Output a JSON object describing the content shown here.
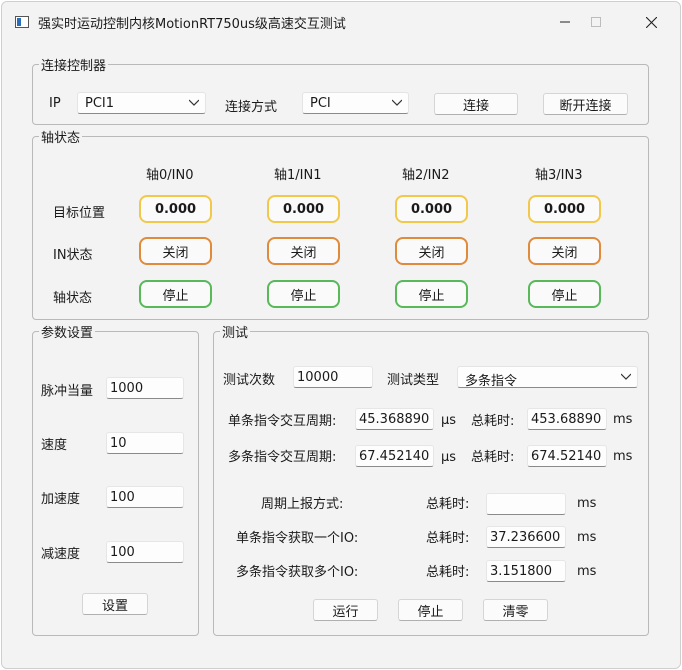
{
  "window": {
    "title": "强实时运动控制内核MotionRT750us级高速交互测试"
  },
  "connect": {
    "legend": "连接控制器",
    "ip_label": "IP",
    "ip_value": "PCI1",
    "mode_label": "连接方式",
    "mode_value": "PCI",
    "connect_button": "连接",
    "disconnect_button": "断开连接"
  },
  "axis_status": {
    "legend": "轴状态",
    "row_labels": [
      "目标位置",
      "IN状态",
      "轴状态"
    ],
    "columns": [
      {
        "header": "轴0/IN0",
        "target": "0.000",
        "in_state": "关闭",
        "axis_state": "停止"
      },
      {
        "header": "轴1/IN1",
        "target": "0.000",
        "in_state": "关闭",
        "axis_state": "停止"
      },
      {
        "header": "轴2/IN2",
        "target": "0.000",
        "in_state": "关闭",
        "axis_state": "停止"
      },
      {
        "header": "轴3/IN3",
        "target": "0.000",
        "in_state": "关闭",
        "axis_state": "停止"
      }
    ],
    "colors": {
      "target_border": "#f2c84b",
      "in_border": "#e08a3c",
      "axis_border": "#58b85a"
    }
  },
  "params": {
    "legend": "参数设置",
    "fields": [
      {
        "label": "脉冲当量",
        "value": "1000"
      },
      {
        "label": "速度",
        "value": "10"
      },
      {
        "label": "加速度",
        "value": "100"
      },
      {
        "label": "减速度",
        "value": "100"
      }
    ],
    "set_button": "设置"
  },
  "test": {
    "legend": "测试",
    "count_label": "测试次数",
    "count_value": "10000",
    "type_label": "测试类型",
    "type_value": "多条指令",
    "single_label": "单条指令交互周期:",
    "single_value": "45.368890",
    "single_unit": "μs",
    "single_total_label": "总耗时:",
    "single_total_value": "453.68890",
    "single_total_unit": "ms",
    "multi_label": "多条指令交互周期:",
    "multi_value": "67.452140",
    "multi_unit": "μs",
    "multi_total_label": "总耗时:",
    "multi_total_value": "674.52140",
    "multi_total_unit": "ms",
    "report_label": "周期上报方式:",
    "report_total_label": "总耗时:",
    "report_value": "",
    "report_unit": "ms",
    "single_io_label": "单条指令获取一个IO:",
    "single_io_total_label": "总耗时:",
    "single_io_value": "37.236600",
    "single_io_unit": "ms",
    "multi_io_label": "多条指令获取多个IO:",
    "multi_io_total_label": "总耗时:",
    "multi_io_value": "3.151800",
    "multi_io_unit": "ms",
    "run_button": "运行",
    "stop_button": "停止",
    "clear_button": "清零"
  }
}
